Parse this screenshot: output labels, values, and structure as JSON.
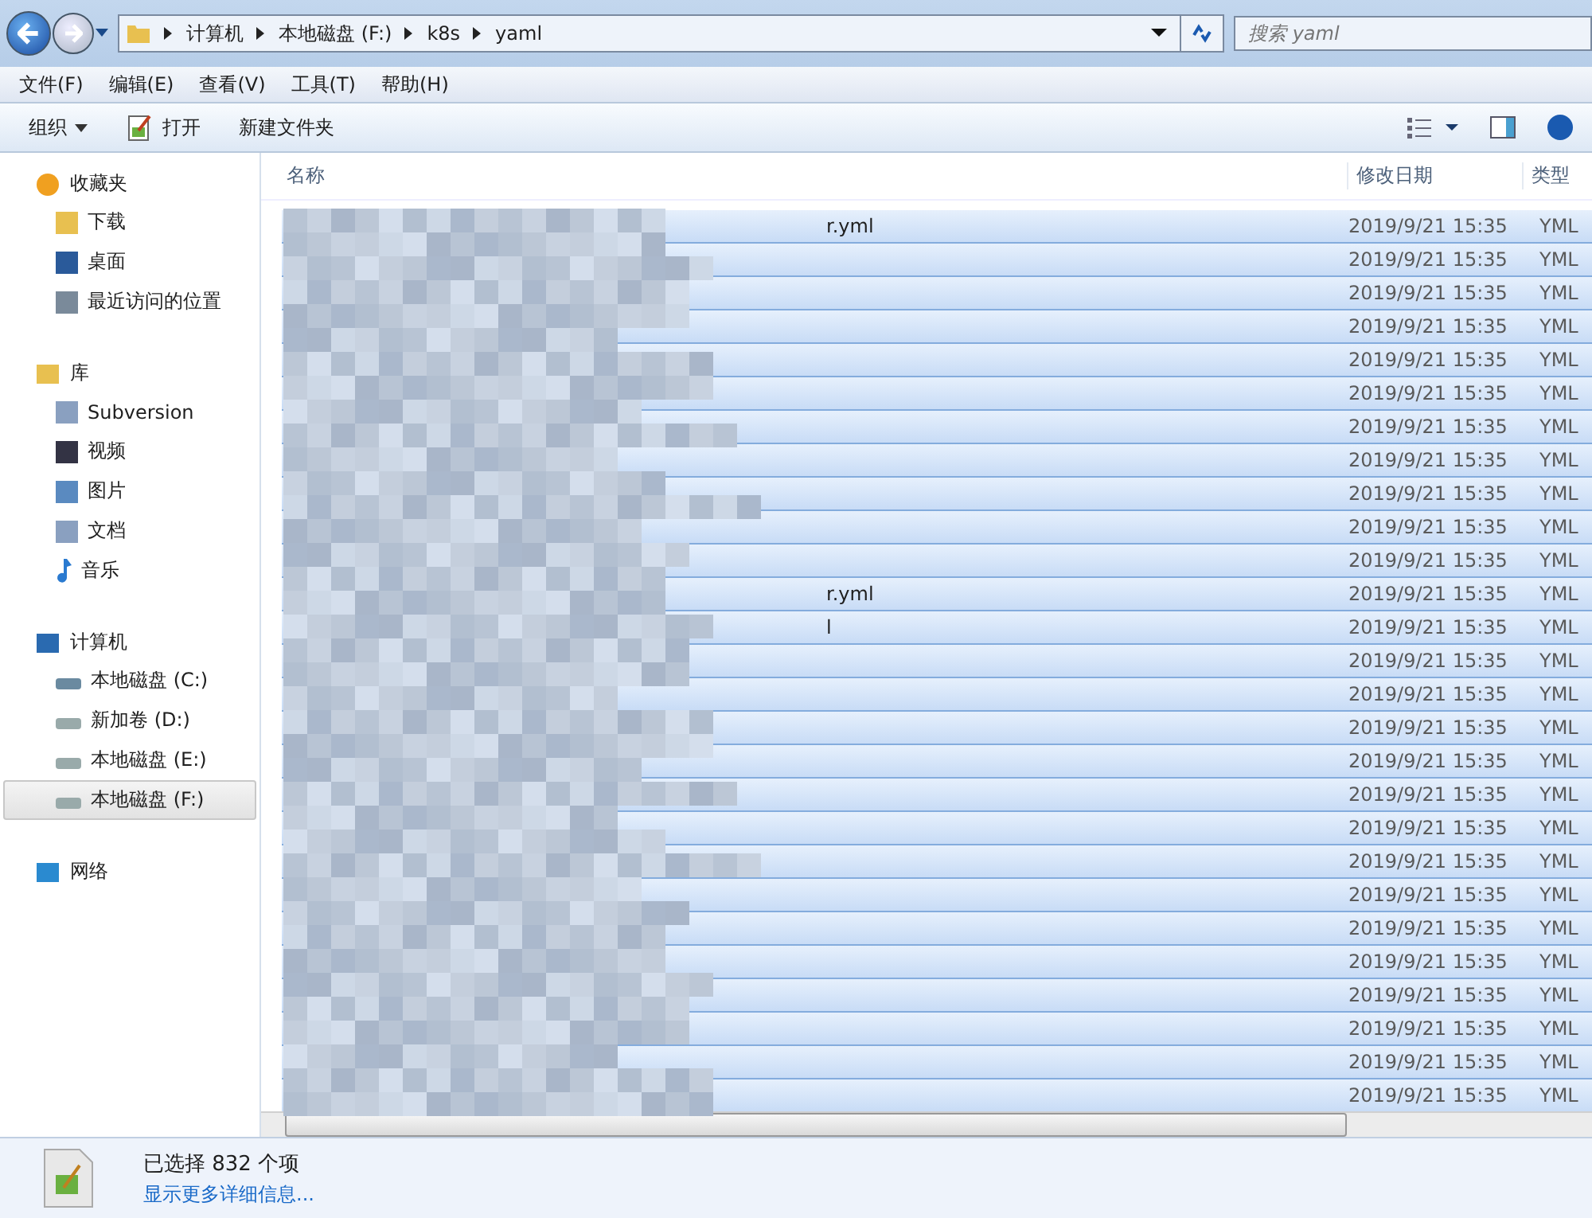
{
  "address_bar": {
    "crumbs": [
      "计算机",
      "本地磁盘 (F:)",
      "k8s",
      "yaml"
    ]
  },
  "search": {
    "placeholder": "搜索 yaml"
  },
  "menu": [
    "文件(F)",
    "编辑(E)",
    "查看(V)",
    "工具(T)",
    "帮助(H)"
  ],
  "toolbar": [
    {
      "label": "组织",
      "kind": "dropdown"
    },
    {
      "label": "打开",
      "kind": "open"
    },
    {
      "label": "新建文件夹",
      "kind": "plain"
    }
  ],
  "sidebar": [
    {
      "label": "收藏夹",
      "kind": "star",
      "children": [
        {
          "label": "下载",
          "kind": "download",
          "selected": false
        },
        {
          "label": "桌面",
          "kind": "desktop",
          "selected": false
        },
        {
          "label": "最近访问的位置",
          "kind": "recent",
          "selected": false
        }
      ]
    },
    {
      "label": "库",
      "kind": "library",
      "children": [
        {
          "label": "Subversion",
          "kind": "doc",
          "selected": false
        },
        {
          "label": "视频",
          "kind": "video",
          "selected": false
        },
        {
          "label": "图片",
          "kind": "image",
          "selected": false
        },
        {
          "label": "文档",
          "kind": "doc",
          "selected": false
        },
        {
          "label": "音乐",
          "kind": "music",
          "selected": false
        }
      ]
    },
    {
      "label": "计算机",
      "kind": "computer",
      "children": [
        {
          "label": "本地磁盘 (C:)",
          "kind": "sysdrive",
          "selected": false
        },
        {
          "label": "新加卷 (D:)",
          "kind": "drive",
          "selected": false
        },
        {
          "label": "本地磁盘 (E:)",
          "kind": "drive",
          "selected": false
        },
        {
          "label": "本地磁盘 (F:)",
          "kind": "drive",
          "selected": true
        }
      ]
    },
    {
      "label": "网络",
      "kind": "network"
    }
  ],
  "table": {
    "columns": [
      "名称",
      "修改日期",
      "类型"
    ],
    "rows": [
      {
        "name": "r.yml",
        "date": "2019/9/21 15:35",
        "type": "YML",
        "selected": true
      },
      {
        "date": "2019/9/21 15:35",
        "type": "YML",
        "selected": true
      },
      {
        "date": "2019/9/21 15:35",
        "type": "YML",
        "selected": true
      },
      {
        "date": "2019/9/21 15:35",
        "type": "YML",
        "selected": true
      },
      {
        "date": "2019/9/21 15:35",
        "type": "YML",
        "selected": true
      },
      {
        "date": "2019/9/21 15:35",
        "type": "YML",
        "selected": true
      },
      {
        "date": "2019/9/21 15:35",
        "type": "YML",
        "selected": true
      },
      {
        "date": "2019/9/21 15:35",
        "type": "YML",
        "selected": true
      },
      {
        "date": "2019/9/21 15:35",
        "type": "YML",
        "selected": true
      },
      {
        "date": "2019/9/21 15:35",
        "type": "YML",
        "selected": true
      },
      {
        "date": "2019/9/21 15:35",
        "type": "YML",
        "selected": true
      },
      {
        "name": "r.yml",
        "date": "2019/9/21 15:35",
        "type": "YML",
        "selected": true
      },
      {
        "name": "l",
        "date": "2019/9/21 15:35",
        "type": "YML",
        "selected": true
      },
      {
        "date": "2019/9/21 15:35",
        "type": "YML",
        "selected": true
      },
      {
        "date": "2019/9/21 15:35",
        "type": "YML",
        "selected": true
      },
      {
        "date": "2019/9/21 15:35",
        "type": "YML",
        "selected": true
      },
      {
        "date": "2019/9/21 15:35",
        "type": "YML",
        "selected": true
      },
      {
        "date": "2019/9/21 15:35",
        "type": "YML",
        "selected": true
      },
      {
        "date": "2019/9/21 15:35",
        "type": "YML",
        "selected": true
      },
      {
        "date": "2019/9/21 15:35",
        "type": "YML",
        "selected": true
      },
      {
        "date": "2019/9/21 15:35",
        "type": "YML",
        "selected": true
      },
      {
        "date": "2019/9/21 15:35",
        "type": "YML",
        "selected": true
      },
      {
        "date": "2019/9/21 15:35",
        "type": "YML",
        "selected": true
      },
      {
        "date": "2019/9/21 15:35",
        "type": "YML",
        "selected": true
      },
      {
        "date": "2019/9/21 15:35",
        "type": "YML",
        "selected": true
      },
      {
        "date": "2019/9/21 15:35",
        "type": "YML",
        "selected": true
      },
      {
        "date": "2019/9/21 15:35",
        "type": "YML",
        "selected": true
      }
    ]
  },
  "status_bar": {
    "summary": "已选择 832 个项",
    "details_link": "显示更多详细信息..."
  }
}
